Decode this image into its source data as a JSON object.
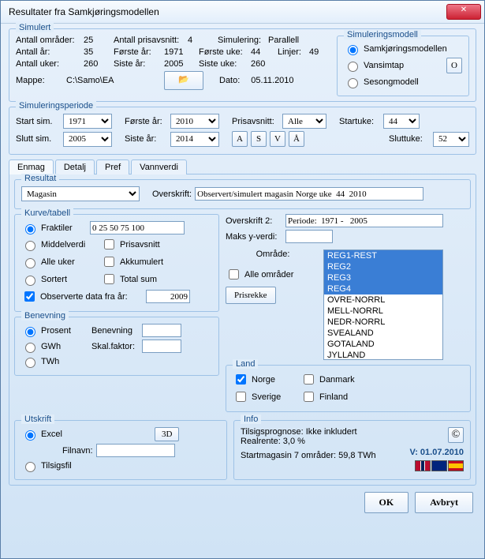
{
  "title": "Resultater fra Samkjøringsmodellen",
  "simulert": {
    "lg": "Simulert",
    "antall_omr_l": "Antall områder:",
    "antall_omr": "25",
    "antall_pris_l": "Antall prisavsnitt:",
    "antall_pris": "4",
    "simulering_l": "Simulering:",
    "simulering": "Parallell",
    "antall_ar_l": "Antall år:",
    "antall_ar": "35",
    "forste_ar_l": "Første år:",
    "forste_ar": "1971",
    "forste_uke_l": "Første uke:",
    "forste_uke": "44",
    "linjer_l": "Linjer:",
    "linjer": "49",
    "antall_uker_l": "Antall uker:",
    "antall_uker": "260",
    "siste_ar_l": "Siste år:",
    "siste_ar": "2005",
    "siste_uke_l": "Siste uke:",
    "siste_uke": "260",
    "mappe_l": "Mappe:",
    "mappe": "C:\\Samo\\EA",
    "dato_l": "Dato:",
    "dato": "05.11.2010"
  },
  "simmodell": {
    "lg": "Simuleringsmodell",
    "r1": "Samkjøringsmodellen",
    "r2": "Vansimtap",
    "r3": "Sesongmodell",
    "o": "O"
  },
  "simperiode": {
    "lg": "Simuleringsperiode",
    "start_l": "Start sim.",
    "start": "1971",
    "slutt_l": "Slutt sim.",
    "slutt": "2005",
    "forste_ar_l": "Første år:",
    "forste_ar": "2010",
    "siste_ar_l": "Siste år:",
    "siste_ar": "2014",
    "pris_l": "Prisavsnitt:",
    "pris": "Alle",
    "startuke_l": "Startuke:",
    "startuke": "44",
    "sluttuke_l": "Sluttuke:",
    "sluttuke": "52",
    "A": "A",
    "S": "S",
    "V": "V",
    "AA": "Å"
  },
  "tabs": {
    "t1": "Enmag",
    "t2": "Detalj",
    "t3": "Pref",
    "t4": "Vannverdi"
  },
  "resultat": {
    "lg": "Resultat",
    "sel": "Magasin",
    "over_l": "Overskrift:",
    "over": "Observert/simulert magasin Norge uke  44  2010",
    "over2_l": "Overskrift 2:",
    "over2": "Periode:  1971 -   2005",
    "maksy_l": "Maks y-verdi:",
    "maksy": ""
  },
  "kurve": {
    "lg": "Kurve/tabell",
    "fraktiler_l": "Fraktiler",
    "fraktiler": "0 25 50 75 100",
    "middel": "Middelverdi",
    "prisav": "Prisavsnitt",
    "alleu": "Alle uker",
    "akkum": "Akkumulert",
    "sort": "Sortert",
    "total": "Total sum",
    "obs_l": "Observerte data fra år:",
    "obs": "2009"
  },
  "omrade": {
    "lbl": "Område:",
    "alle": "Alle områder",
    "prisrekke": "Prisrekke",
    "items": [
      "REG1-REST",
      "REG2",
      "REG3",
      "REG4",
      "OVRE-NORRL",
      "MELL-NORRL",
      "NEDR-NORRL",
      "SVEALAND",
      "GOTALAND",
      "JYLLAND"
    ]
  },
  "benevning": {
    "lg": "Benevning",
    "prosent": "Prosent",
    "gwh": "GWh",
    "twh": "TWh",
    "ben_l": "Benevning",
    "skal_l": "Skal.faktor:"
  },
  "land": {
    "lg": "Land",
    "norge": "Norge",
    "sverige": "Sverige",
    "danmark": "Danmark",
    "finland": "Finland"
  },
  "utskrift": {
    "lg": "Utskrift",
    "excel": "Excel",
    "tilsig": "Tilsigsfil",
    "fil_l": "Filnavn:",
    "d3": "3D"
  },
  "info": {
    "lg": "Info",
    "l1": "Tilsigsprognose: Ikke inkludert",
    "l2": "Realrente: 3,0 %",
    "l3": "Startmagasin  7 områder: 59,8 TWh",
    "copy": "©",
    "ver": "V: 01.07.2010"
  },
  "ok": "OK",
  "avbryt": "Avbryt"
}
